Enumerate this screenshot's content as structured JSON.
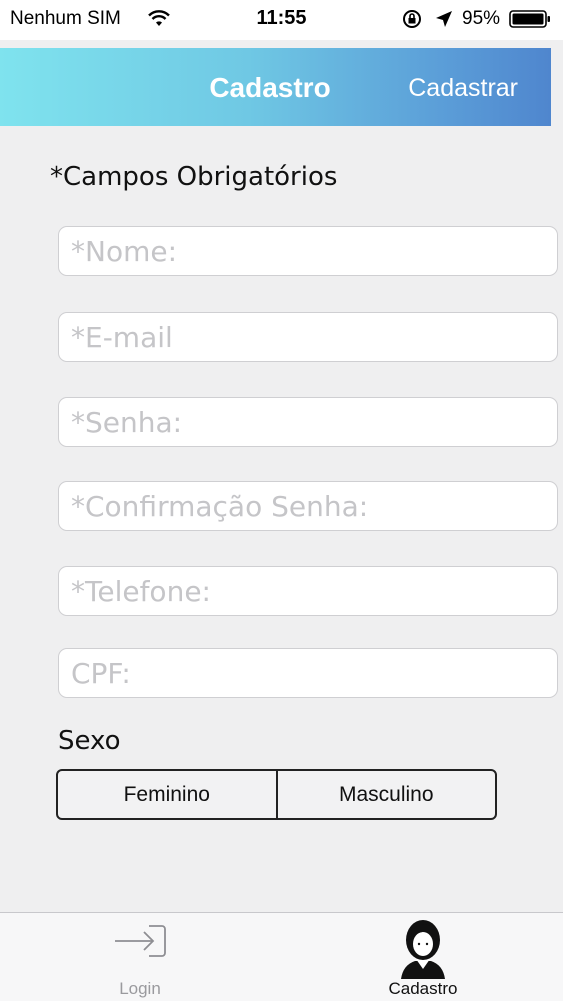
{
  "status_bar": {
    "carrier": "Nenhum SIM",
    "time": "11:55",
    "battery": "95%"
  },
  "nav": {
    "title": "Cadastro",
    "action": "Cadastrar"
  },
  "form": {
    "required_note": "*Campos Obrigatórios",
    "fields": [
      {
        "placeholder": "*Nome:",
        "value": ""
      },
      {
        "placeholder": "*E-mail",
        "value": ""
      },
      {
        "placeholder": "*Senha:",
        "value": ""
      },
      {
        "placeholder": "*Confirmação Senha:",
        "value": ""
      },
      {
        "placeholder": "*Telefone:",
        "value": ""
      },
      {
        "placeholder": "CPF:",
        "value": ""
      }
    ],
    "sexo_label": "Sexo",
    "sexo_options": [
      "Feminino",
      "Masculino"
    ]
  },
  "tabs": [
    {
      "label": "Login",
      "icon": "login-arrow-icon",
      "selected": false
    },
    {
      "label": "Cadastro",
      "icon": "woman-avatar-icon",
      "selected": true
    }
  ],
  "colors": {
    "nav_gradient_start": "#7fe3ee",
    "nav_gradient_end": "#4f86ce",
    "background": "#efeff0"
  }
}
